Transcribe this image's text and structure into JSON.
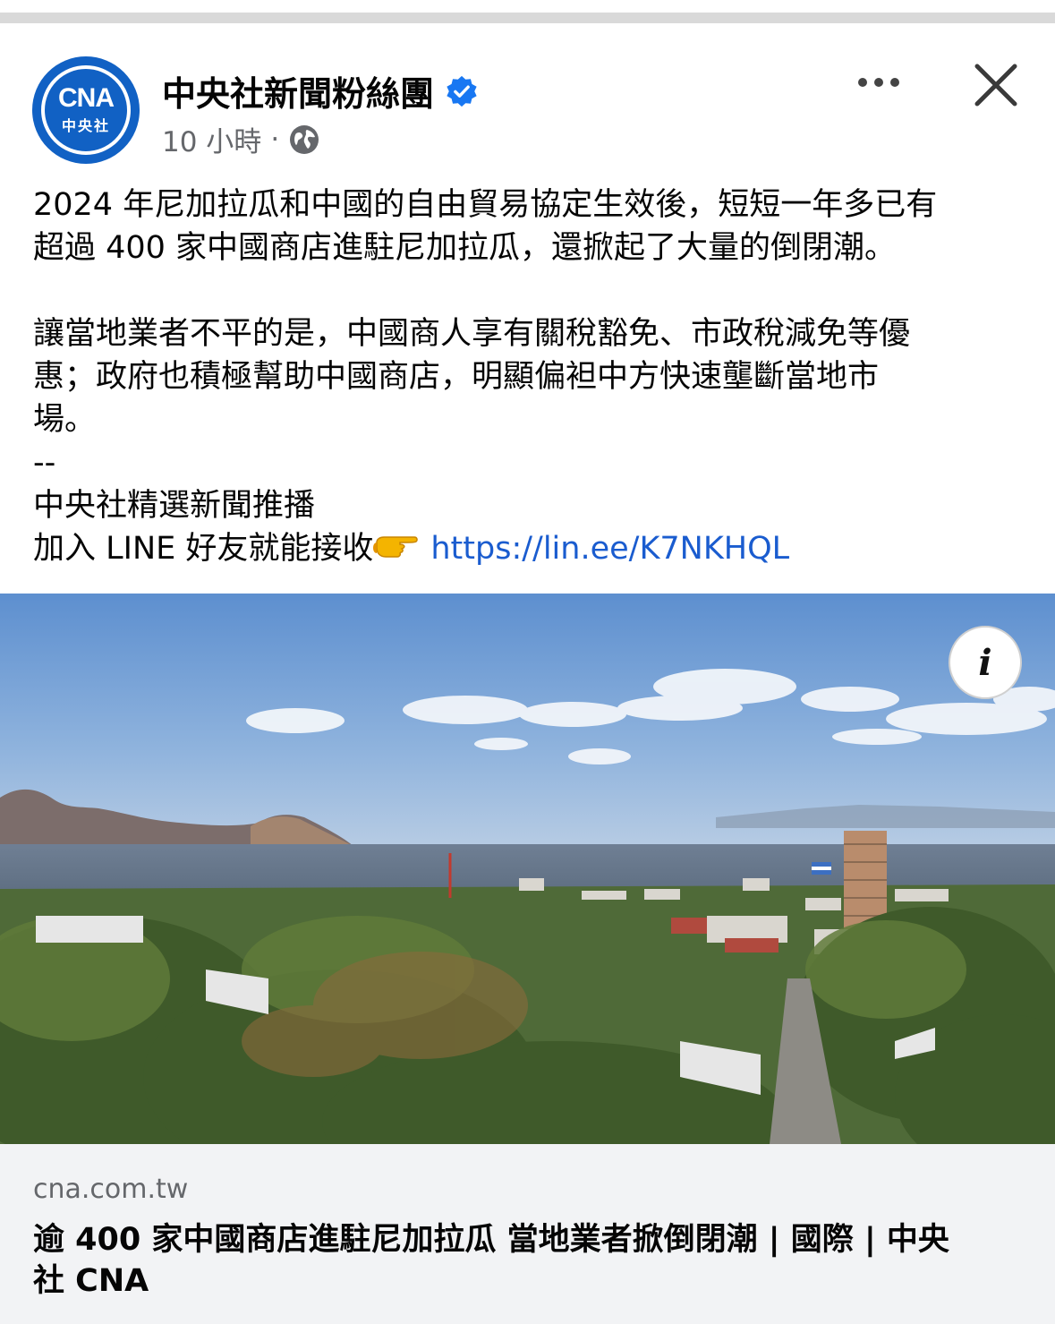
{
  "post": {
    "author": "中央社新聞粉絲團",
    "avatar_logo_text": "CNA",
    "avatar_logo_subtext": "中央社",
    "timestamp": "10 小時",
    "separator": "·",
    "lines_para1": [
      "2024 年尼加拉瓜和中國的自由貿易協定生效後，短短一年多已有",
      "超過 400 家中國商店進駐尼加拉瓜，還掀起了大量的倒閉潮。"
    ],
    "lines_para2": [
      "讓當地業者不平的是，中國商人享有關稅豁免、市政稅減免等優",
      "惠；政府也積極幫助中國商店，明顯偏袒中方快速壟斷當地市",
      "場。"
    ],
    "dashes": "--",
    "promo_line": "中央社精選新聞推播",
    "line_prefix": "加入 LINE 好友就能接收",
    "link_url": "https://lin.ee/K7NKHQL"
  },
  "image": {
    "info_label": "i"
  },
  "preview": {
    "domain": "cna.com.tw",
    "headline_line1": "逾 400 家中國商店進駐尼加拉瓜 當地業者掀倒閉潮 | 國際 | 中央",
    "headline_line2": "社 CNA"
  },
  "colors": {
    "brand_blue": "#1161c4",
    "verified_blue": "#1877f2",
    "link_blue": "#1a5ccf",
    "meta_gray": "#65676b",
    "preview_bg": "#f2f3f5"
  },
  "icons": {
    "verified": "verified-badge-icon",
    "audience": "globe-icon",
    "more": "more-options-icon",
    "close": "close-icon",
    "pointing": "pointing-hand-emoji",
    "info": "info-icon"
  }
}
